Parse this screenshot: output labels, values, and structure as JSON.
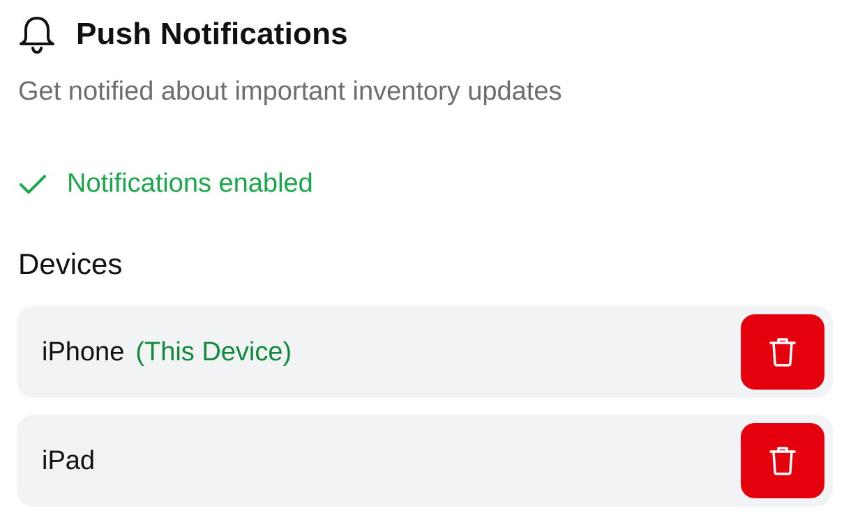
{
  "header": {
    "icon": "bell-icon",
    "title": "Push Notifications",
    "subtitle": "Get notified about important inventory updates"
  },
  "status": {
    "icon": "check-icon",
    "text": "Notifications enabled",
    "color": "#1aa64a"
  },
  "devices": {
    "heading": "Devices",
    "items": [
      {
        "name": "iPhone",
        "tag": "(This Device)",
        "delete_icon": "trash-icon"
      },
      {
        "name": "iPad",
        "tag": "",
        "delete_icon": "trash-icon"
      }
    ]
  },
  "colors": {
    "delete": "#e5000d",
    "row_background": "#f2f3f5",
    "this_device_tag": "#128a3c",
    "subtitle": "#6e6e6e"
  }
}
